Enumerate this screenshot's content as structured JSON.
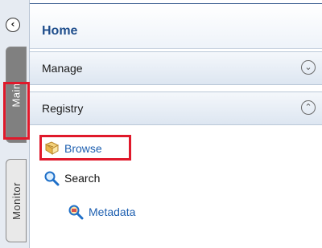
{
  "colors": {
    "highlight": "#e0192b",
    "link": "#1d5fb0",
    "home_title": "#1f4e8c",
    "main_tab": "#808080"
  },
  "sidebar": {
    "collapse_icon": "chevron-left-icon",
    "tabs": [
      {
        "label": "Main",
        "selected": true
      },
      {
        "label": "Monitor",
        "selected": false
      }
    ]
  },
  "panel": {
    "home_label": "Home",
    "sections": [
      {
        "label": "Manage",
        "state": "collapsed",
        "toggle_icon": "chevron-down-circle-icon"
      },
      {
        "label": "Registry",
        "state": "expanded",
        "toggle_icon": "chevron-up-circle-icon"
      }
    ],
    "registry_items": [
      {
        "label": "Browse",
        "icon": "browse-book-icon",
        "highlighted": true
      },
      {
        "label": "Search",
        "icon": "magnifier-icon"
      },
      {
        "label": "Metadata",
        "icon": "metadata-search-icon"
      }
    ]
  }
}
